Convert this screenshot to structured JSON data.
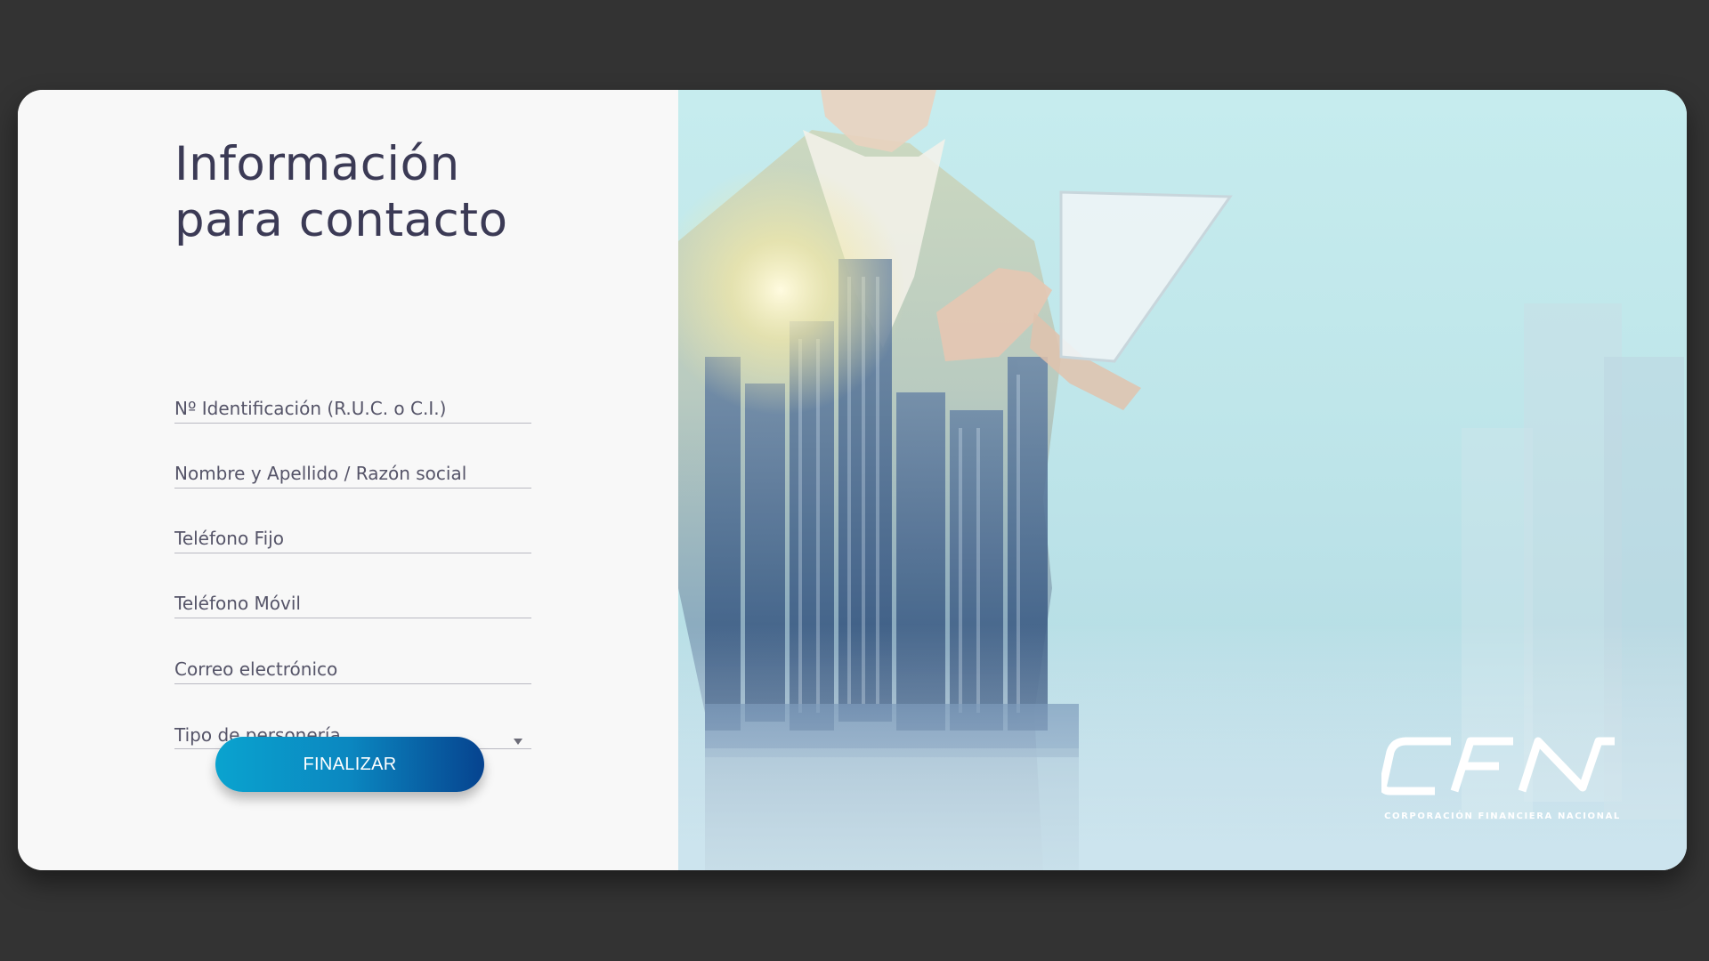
{
  "title": {
    "line1": "Información",
    "line2": "para contacto"
  },
  "form": {
    "fields": [
      {
        "placeholder": "Nº Identificación (R.U.C. o C.I.)",
        "value": ""
      },
      {
        "placeholder": "Nombre y Apellido / Razón social",
        "value": ""
      },
      {
        "placeholder": "Teléfono Fijo",
        "value": ""
      },
      {
        "placeholder": "Teléfono Móvil",
        "value": ""
      },
      {
        "placeholder": "Correo electrónico",
        "value": ""
      }
    ],
    "select": {
      "label": "Tipo de personería",
      "icon": "chevron-down-icon"
    },
    "submit_label": "FINALIZAR"
  },
  "brand": {
    "logo_text": "CFN",
    "tagline": "CORPORACIÓN FINANCIERA NACIONAL"
  },
  "colors": {
    "background": "#333333",
    "card": "#f8f8f8",
    "title": "#3b3a55",
    "button_start": "#0aa3cf",
    "button_end": "#06438f"
  }
}
